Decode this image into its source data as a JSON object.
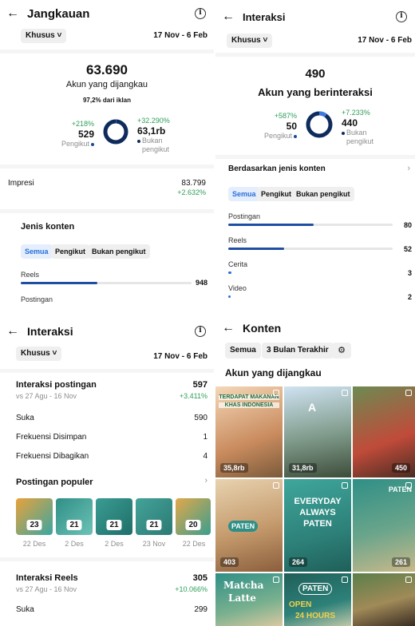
{
  "panel1": {
    "title": "Jangkauan",
    "filter": "Khusus",
    "date_range": "17 Nov - 6 Feb",
    "big_number": "63.690",
    "label": "Akun yang dijangkau",
    "ads_note": "97,2% dari iklan",
    "followers": {
      "pct": "+218%",
      "value": "529",
      "label": "Pengikut"
    },
    "non_followers": {
      "pct": "+32.290%",
      "value": "63,1rb",
      "label1": "Bukan",
      "label2": "pengikut"
    },
    "followers_share": 0.008,
    "impressions": {
      "label": "Impresi",
      "value": "83.799",
      "pct": "+2.632%"
    },
    "content_section": "Jenis konten",
    "segments": [
      "Semua",
      "Pengikut",
      "Bukan pengikut"
    ],
    "bars": [
      {
        "label": "Reels",
        "value": "948",
        "fraction": 0.45
      },
      {
        "label": "Postingan",
        "value": "",
        "fraction": 0.0
      }
    ]
  },
  "panel2": {
    "title": "Interaksi",
    "filter": "Khusus",
    "date_range": "17 Nov - 6 Feb",
    "big_number": "490",
    "label": "Akun yang berinteraksi",
    "followers": {
      "pct": "+587%",
      "value": "50",
      "label": "Pengikut"
    },
    "non_followers": {
      "pct": "+7.233%",
      "value": "440",
      "label1": "Bukan",
      "label2": "pengikut"
    },
    "followers_share": 0.1,
    "content_section": "Berdasarkan jenis konten",
    "segments": [
      "Semua",
      "Pengikut",
      "Bukan pengikut"
    ],
    "bars": [
      {
        "label": "Postingan",
        "value": "80",
        "fraction": 0.52
      },
      {
        "label": "Reels",
        "value": "52",
        "fraction": 0.34
      },
      {
        "label": "Cerita",
        "value": "3",
        "fraction": 0.02
      },
      {
        "label": "Video",
        "value": "2",
        "fraction": 0.015
      }
    ]
  },
  "panel3": {
    "title": "Interaksi",
    "filter": "Khusus",
    "date_range": "17 Nov - 6 Feb",
    "post_interactions": {
      "label": "Interaksi postingan",
      "compare": "vs 27 Agu - 16 Nov",
      "value": "597",
      "pct": "+3.411%"
    },
    "rows": [
      {
        "label": "Suka",
        "value": "590"
      },
      {
        "label": "Frekuensi Disimpan",
        "value": "1"
      },
      {
        "label": "Frekuensi Dibagikan",
        "value": "4"
      }
    ],
    "popular_title": "Postingan populer",
    "popular": [
      {
        "count": "23",
        "date": "22 Des"
      },
      {
        "count": "21",
        "date": "2 Des"
      },
      {
        "count": "21",
        "date": "2 Des"
      },
      {
        "count": "21",
        "date": "23 Nov"
      },
      {
        "count": "20",
        "date": "22 Des"
      }
    ],
    "reels_interactions": {
      "label": "Interaksi Reels",
      "compare": "vs 27 Agu - 16 Nov",
      "value": "305",
      "pct": "+10.066%"
    },
    "reels_rows": [
      {
        "label": "Suka",
        "value": "299"
      }
    ]
  },
  "panel4": {
    "title": "Konten",
    "chips": [
      "Semua",
      "3 Bulan Terakhir"
    ],
    "section": "Akun yang dijangkau",
    "tiles": [
      {
        "value": "35,8rb"
      },
      {
        "value": "31,8rb"
      },
      {
        "value": "450"
      },
      {
        "value": "403"
      },
      {
        "value": "264"
      },
      {
        "value": "261"
      },
      {
        "value": ""
      },
      {
        "value": ""
      },
      {
        "value": ""
      }
    ],
    "tile_text": {
      "t1a": "TERDAPAT MAKANAN",
      "t1b": "KHAS INDONESIA",
      "t5a": "EVERYDAY",
      "t5b": "ALWAYS",
      "t5c": "PATEN",
      "t7a": "Matcha",
      "t7b": "Latte",
      "t8a": "PATEN",
      "t8b": "OPEN",
      "t8c": "24 HOURS",
      "t4": "PATEN",
      "t6": "PATEN"
    }
  },
  "colors": {
    "accent": "#1f4ea3",
    "green": "#2f9e5a",
    "donut": "#0e2b5c"
  }
}
